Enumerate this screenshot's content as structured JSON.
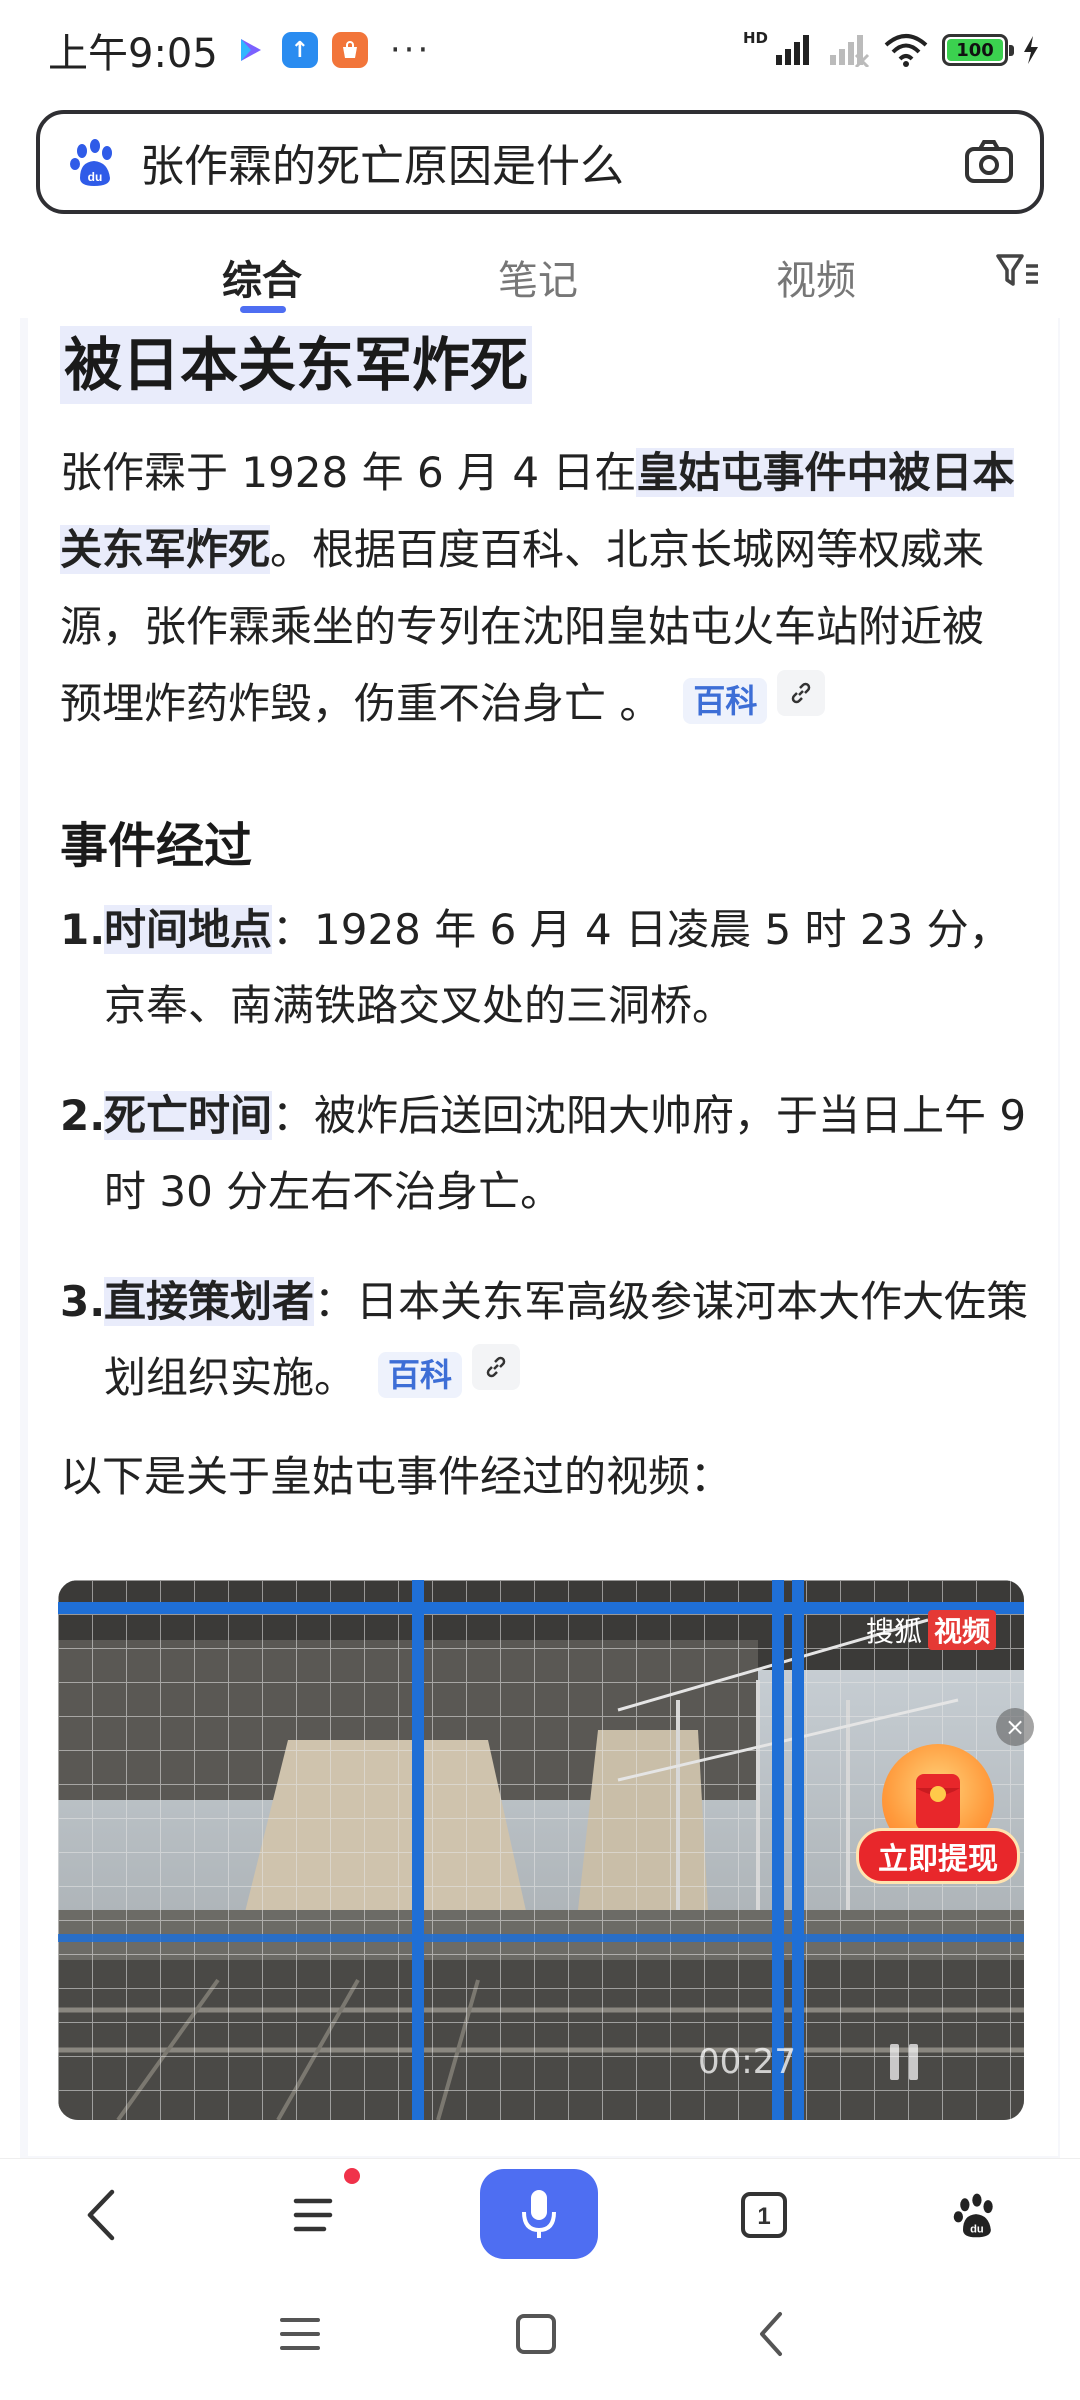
{
  "status_bar": {
    "time": "上午9:05",
    "dots": "···",
    "hd": "HD",
    "battery": "100"
  },
  "search": {
    "query": "张作霖的死亡原因是什么"
  },
  "tabs": [
    {
      "label": "综合",
      "active": true
    },
    {
      "label": "笔记",
      "active": false
    },
    {
      "label": "视频",
      "active": false
    }
  ],
  "answer": {
    "title": "被日本关东军炸死",
    "intro_prefix": "张作霖于 1928 年 6 月 4 日在",
    "intro_bold": "皇姑屯事件中被日本关东军炸死",
    "intro_rest": "。根据百度百科、北京长城网等权威来源，张作霖乘坐的专列在沈阳皇姑屯火车站附近被预埋炸药炸毁，伤重不治身亡 。",
    "cite_label": "百科",
    "section_title": "事件经过",
    "items": [
      {
        "num": "1.",
        "label": "时间地点",
        "text": "：1928 年 6 月 4 日凌晨 5 时 23 分，京奉、南满铁路交叉处的三洞桥。"
      },
      {
        "num": "2.",
        "label": "死亡时间",
        "text": "：被炸后送回沈阳大帅府，于当日上午 9 时 30 分左右不治身亡。"
      },
      {
        "num": "3.",
        "label": "直接策划者",
        "text": "：日本关东军高级参谋河本大作大佐策划组织实施。"
      }
    ],
    "item3_cite": "百科",
    "video_intro": "以下是关于皇姑屯事件经过的视频："
  },
  "video": {
    "watermark_text": "搜狐",
    "watermark_badge": "视频",
    "time": "00:27"
  },
  "promo": {
    "label": "立即提现",
    "close": "×"
  },
  "bottom_bar": {
    "tab_count": "1"
  },
  "colors": {
    "accent": "#4e6ef2",
    "highlight": "#e9ecfb",
    "cite_blue": "#3d6ed6",
    "promo_red": "#e8272b"
  }
}
